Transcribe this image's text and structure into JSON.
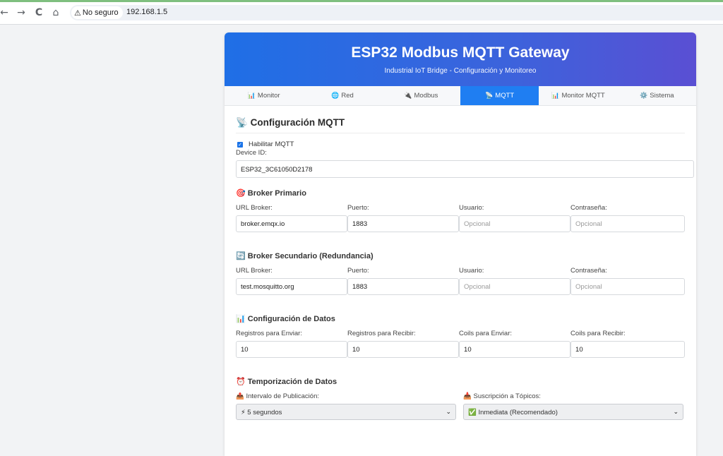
{
  "browser": {
    "back_icon": "←",
    "forward_icon": "→",
    "reload_icon": "C",
    "home_icon": "⌂",
    "security_icon": "⚠",
    "security_label": "No seguro",
    "url": "192.168.1.5"
  },
  "header": {
    "title": "ESP32 Modbus MQTT Gateway",
    "subtitle": "Industrial IoT Bridge - Configuración y Monitoreo"
  },
  "tabs": [
    {
      "icon": "📊",
      "label": "Monitor"
    },
    {
      "icon": "🌐",
      "label": "Red"
    },
    {
      "icon": "🔌",
      "label": "Modbus"
    },
    {
      "icon": "📡",
      "label": "MQTT"
    },
    {
      "icon": "📊",
      "label": "Monitor MQTT"
    },
    {
      "icon": "⚙️",
      "label": "Sistema"
    }
  ],
  "mqtt": {
    "section_icon": "📡",
    "section_title": "Configuración MQTT",
    "enable_label": "Habilitar MQTT",
    "enable_check": "✓",
    "device_id_label": "Device ID:",
    "device_id_value": "ESP32_3C61050D2178",
    "primary": {
      "icon": "🎯",
      "title": "Broker Primario",
      "url_label": "URL Broker:",
      "url_value": "broker.emqx.io",
      "port_label": "Puerto:",
      "port_value": "1883",
      "user_label": "Usuario:",
      "user_placeholder": "Opcional",
      "pass_label": "Contraseña:",
      "pass_placeholder": "Opcional"
    },
    "secondary": {
      "icon": "🔄",
      "title": "Broker Secundario (Redundancia)",
      "url_label": "URL Broker:",
      "url_value": "test.mosquitto.org",
      "port_label": "Puerto:",
      "port_value": "1883",
      "user_label": "Usuario:",
      "user_placeholder": "Opcional",
      "pass_label": "Contraseña:",
      "pass_placeholder": "Opcional"
    },
    "data_config": {
      "icon": "📊",
      "title": "Configuración de Datos",
      "send_regs_label": "Registros para Enviar:",
      "send_regs_value": "10",
      "recv_regs_label": "Registros para Recibir:",
      "recv_regs_value": "10",
      "send_coils_label": "Coils para Enviar:",
      "send_coils_value": "10",
      "recv_coils_label": "Coils para Recibir:",
      "recv_coils_value": "10"
    },
    "timing": {
      "icon": "⏰",
      "title": "Temporización de Datos",
      "publish_icon": "📤",
      "publish_label": "Intervalo de Publicación:",
      "publish_value": "⚡ 5 segundos",
      "subscribe_icon": "📥",
      "subscribe_label": "Suscripción a Tópicos:",
      "subscribe_value": "✅ Inmediata (Recomendado)",
      "chevron": "⌄"
    }
  }
}
